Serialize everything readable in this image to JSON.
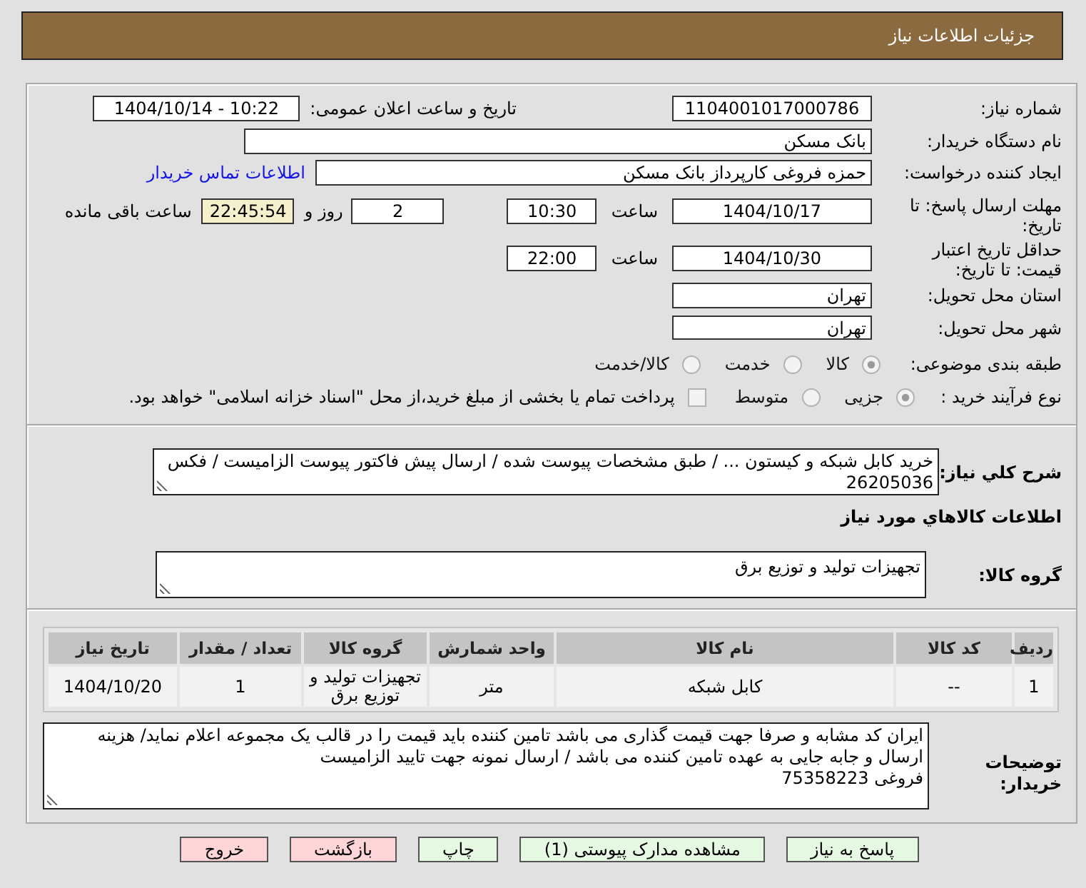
{
  "header": {
    "title": "جزئیات اطلاعات نیاز"
  },
  "details": {
    "need_number": {
      "label": "شماره نیاز:",
      "value": "1104001017000786"
    },
    "announcement": {
      "label": "تاریخ و ساعت اعلان عمومی:",
      "value": "1404/10/14 - 10:22"
    },
    "buyer_org": {
      "label": "نام دستگاه خریدار:",
      "value": "بانک مسکن"
    },
    "requester": {
      "label": "ایجاد کننده درخواست:",
      "value": "حمزه فروغی کارپرداز بانک مسکن",
      "link": "اطلاعات تماس خریدار"
    },
    "reply_deadline": {
      "label": "مهلت ارسال پاسخ: تا تاریخ:",
      "date": "1404/10/17",
      "time_label": "ساعت",
      "time": "10:30",
      "days": "2",
      "days_label": "روز و",
      "remaining": "22:45:54",
      "remaining_label": "ساعت باقی مانده"
    },
    "price_validity": {
      "label": "حداقل تاریخ اعتبار قیمت: تا تاریخ:",
      "date": "1404/10/30",
      "time_label": "ساعت",
      "time": "22:00"
    },
    "delivery_province": {
      "label": "استان محل تحویل:",
      "value": "تهران"
    },
    "delivery_city": {
      "label": "شهر محل تحویل:",
      "value": "تهران"
    },
    "category": {
      "label": "طبقه بندی موضوعی:",
      "options": [
        {
          "label": "کالا",
          "selected": true
        },
        {
          "label": "خدمت",
          "selected": false
        },
        {
          "label": "کالا/خدمت",
          "selected": false
        }
      ]
    },
    "purchase_process": {
      "label": "نوع فرآیند خرید :",
      "options": [
        {
          "label": "جزیی",
          "selected": true
        },
        {
          "label": "متوسط",
          "selected": false
        }
      ],
      "treasury_payment": {
        "label": "پرداخت تمام یا بخشی از مبلغ خرید،از محل \"اسناد خزانه اسلامی\" خواهد بود.",
        "checked": false
      }
    }
  },
  "summary": {
    "label": "شرح کلي نياز:",
    "value": "خرید کابل شبکه و کیستون ... / طبق مشخصات پیوست شده / ارسال پیش فاکتور پیوست الزامیست / فکس 26205036"
  },
  "goods": {
    "title": "اطلاعات کالاهاي مورد نياز",
    "group_label": "گروه کالا:",
    "group_value": "تجهیزات تولید و توزیع برق",
    "table": {
      "columns": [
        "ردیف",
        "کد کالا",
        "نام کالا",
        "واحد شمارش",
        "گروه کالا",
        "تعداد / مقدار",
        "تاریخ نیاز"
      ],
      "rows": [
        {
          "cells": [
            "1",
            "--",
            "کابل شبکه",
            "متر",
            "تجهیزات تولید و توزیع برق",
            "1",
            "1404/10/20"
          ]
        }
      ]
    }
  },
  "buyer_notes": {
    "label": "توضیحات خریدار:",
    "value": "ایران کد مشابه و صرفا جهت قیمت گذاری می باشد تامین کننده باید قیمت را در قالب یک مجموعه اعلام نماید/ هزینه ارسال و جابه جایی به عهده تامین کننده می باشد / ارسال نمونه جهت تایید الزامیست\nفروغی 75358223"
  },
  "buttons": [
    {
      "label": "پاسخ به نیاز",
      "kind": "primary"
    },
    {
      "label": "مشاهده مدارک پیوستی (1)",
      "kind": "primary"
    },
    {
      "label": "چاپ",
      "kind": "primary"
    },
    {
      "label": "بازگشت",
      "kind": "cancel"
    },
    {
      "label": "خروج",
      "kind": "cancel"
    }
  ]
}
